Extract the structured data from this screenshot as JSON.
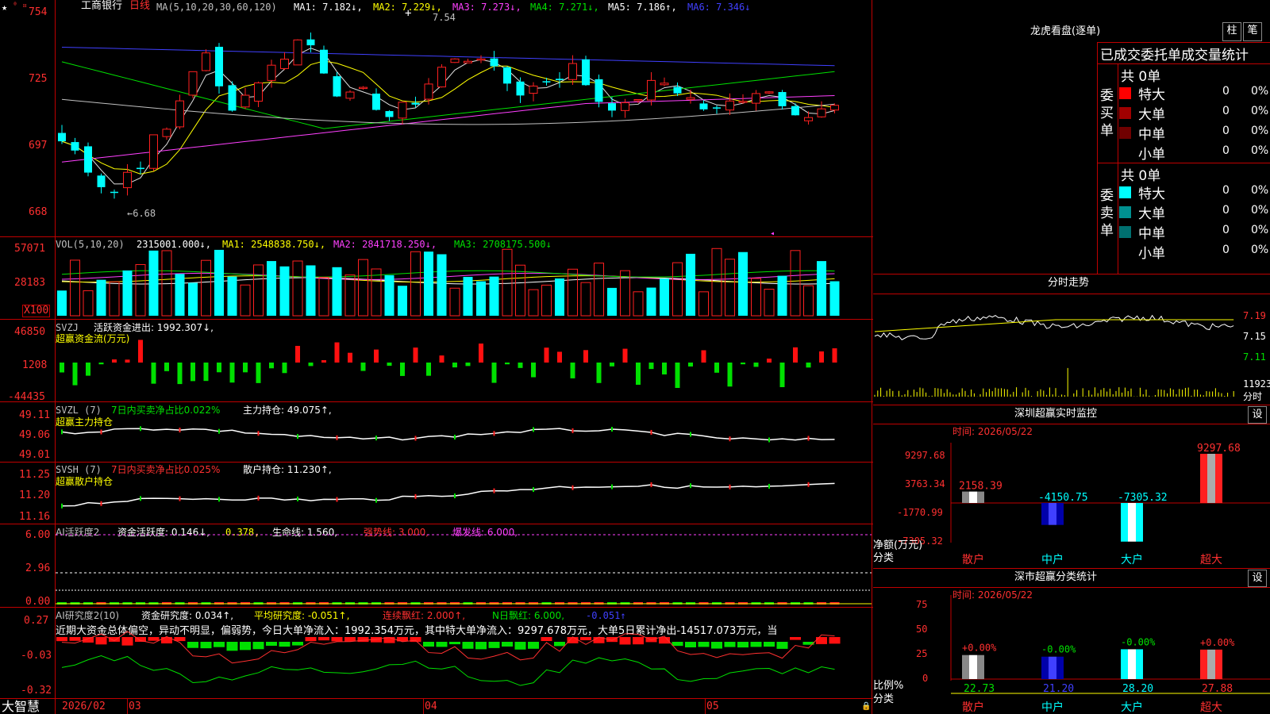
{
  "app": {
    "brand": "大智慧",
    "date_axis": [
      "2026/02",
      "03",
      "04",
      "05"
    ]
  },
  "header": {
    "stock_name": "工商银行",
    "period": "日线",
    "ma_label": "MA(5,10,20,30,60,120)",
    "ma1": "MA1: 7.182↓,",
    "ma2": "MA2: 7.229↓,",
    "ma3": "MA3: 7.273↓,",
    "ma4": "MA4: 7.271↓,",
    "ma5": "MA5: 7.186↑,",
    "ma6": "MA6: 7.346↓"
  },
  "main_axis": [
    "754",
    "725",
    "697",
    "668"
  ],
  "annotations": {
    "high": "7.54",
    "low": "←6.68"
  },
  "vol": {
    "title": "VOL(5,10,20)",
    "value": "2315001.000↓,",
    "ma1": "MA1: 2548838.750↓,",
    "ma2": "MA2: 2841718.250↓,",
    "ma3": "MA3: 2708175.500↓",
    "axis": [
      "57071",
      "28183"
    ],
    "unit": "X100"
  },
  "svzj": {
    "name": "SVZJ",
    "label": "活跃资金进出: 1992.307↓,",
    "sub": "超赢资金流(万元)",
    "axis": [
      "46850",
      "1208",
      "-44435"
    ]
  },
  "svzl": {
    "name": "SVZL (7)",
    "desc": "7日内买卖净占比0.022%",
    "label": "主力持仓: 49.075↑,",
    "sub": "超赢主力持仓",
    "axis": [
      "49.11",
      "49.06",
      "49.01"
    ]
  },
  "svsh": {
    "name": "SVSH (7)",
    "desc": "7日内买卖净占比0.025%",
    "label": "散户持仓: 11.230↑,",
    "sub": "超赢散户持仓",
    "axis": [
      "11.25",
      "11.20",
      "11.16"
    ]
  },
  "ai_active": {
    "name": "AI活跃度2",
    "label1": "资金活跃度: 0.146↓,",
    "v2": "0.378,",
    "v3": "生命线: 1.560,",
    "v4": "强势线: 3.000,",
    "v5": "爆发线: 6.000,",
    "axis": [
      "6.00",
      "2.96",
      "0.00"
    ]
  },
  "ai_research": {
    "name": "AI研究度2(10)",
    "l1": "资金研究度: 0.034↑,",
    "l2": "平均研究度: -0.051↑,",
    "l3": "连续飘红: 2.000↑,",
    "l4": "N日飘红: 6.000,",
    "l5": "-0.051↑",
    "text": "近期大资金总体偏空，异动不明显，偏弱势，今日大单净流入：1992.354万元，其中特大单净流入：9297.678万元，大单5日累计净出-14517.073万元，当",
    "axis": [
      "0.27",
      "-0.03",
      "-0.32"
    ]
  },
  "right_top": {
    "title": "龙虎看盘(逐单)",
    "btn1": "柱",
    "btn2": "笔",
    "header": "已成交委托单成交量统计",
    "buy_label": "委买单",
    "sell_label": "委卖单",
    "buy_total": "共 0单",
    "sell_total": "共 0单",
    "buy_rows": [
      {
        "name": "特大",
        "n": "0",
        "p": "0%",
        "color": "#ff0000"
      },
      {
        "name": "大单",
        "n": "0",
        "p": "0%",
        "color": "#a00000"
      },
      {
        "name": "中单",
        "n": "0",
        "p": "0%",
        "color": "#700000"
      },
      {
        "name": "小单",
        "n": "0",
        "p": "0%",
        "color": ""
      }
    ],
    "sell_rows": [
      {
        "name": "特大",
        "n": "0",
        "p": "0%",
        "color": "#00ffff"
      },
      {
        "name": "大单",
        "n": "0",
        "p": "0%",
        "color": "#009090"
      },
      {
        "name": "中单",
        "n": "0",
        "p": "0%",
        "color": "#007070"
      },
      {
        "name": "小单",
        "n": "0",
        "p": "0%",
        "color": ""
      }
    ]
  },
  "intraday": {
    "title": "分时走势",
    "axis": [
      "7.19",
      "7.15",
      "7.11"
    ],
    "vol_axis": "11923",
    "vol_label": "分时"
  },
  "sz_monitor": {
    "title": "深圳超赢实时监控",
    "btn": "设",
    "time": "时间: 2026/05/22",
    "axis": [
      "9297.68",
      "3763.34",
      "-1770.99",
      "-7305.32"
    ],
    "ylabel": "净额(万元)",
    "xlabel": "分类",
    "categories": [
      "散户",
      "中户",
      "大户",
      "超大"
    ],
    "values": [
      2158.39,
      -4150.75,
      -7305.32,
      9297.68
    ],
    "labels": [
      "2158.39",
      "-4150.75",
      "-7305.32",
      "9297.68"
    ]
  },
  "sz_class": {
    "title": "深市超赢分类统计",
    "btn": "设",
    "time": "时间: 2026/05/22",
    "axis": [
      "75",
      "50",
      "25",
      "0"
    ],
    "ylabel": "比例%",
    "xlabel": "分类",
    "categories": [
      "散户",
      "中户",
      "大户",
      "超大"
    ],
    "values": [
      22.73,
      21.2,
      28.2,
      27.88
    ],
    "labels": [
      "22.73",
      "21.20",
      "28.20",
      "27.88"
    ],
    "changes": [
      "+0.00%",
      "-0.00%",
      "-0.00%",
      "+0.00%"
    ]
  },
  "chart_data": [
    {
      "type": "bar",
      "title": "深圳超赢实时监控",
      "ylabel": "净额(万元)",
      "xlabel": "分类",
      "categories": [
        "散户",
        "中户",
        "大户",
        "超大"
      ],
      "values": [
        2158.39,
        -4150.75,
        -7305.32,
        9297.68
      ]
    },
    {
      "type": "bar",
      "title": "深市超赢分类统计",
      "ylabel": "比例%",
      "xlabel": "分类",
      "categories": [
        "散户",
        "中户",
        "大户",
        "超大"
      ],
      "values": [
        22.73,
        21.2,
        28.2,
        27.88
      ],
      "ylim": [
        0,
        75
      ]
    }
  ]
}
